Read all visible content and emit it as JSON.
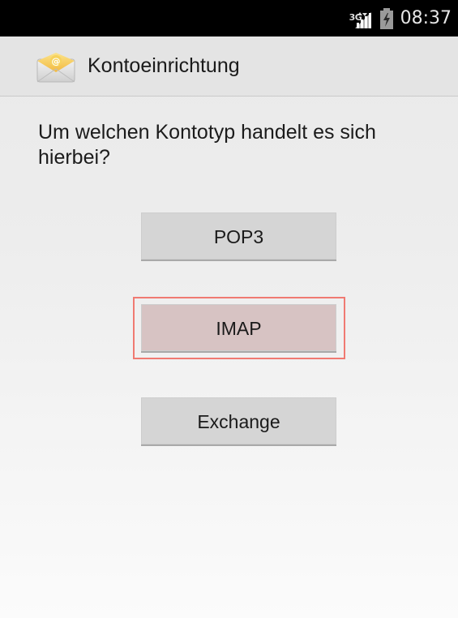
{
  "status_bar": {
    "network_type": "3G",
    "time": "08:37"
  },
  "action_bar": {
    "title": "Kontoeinrichtung",
    "icon": "email-app-icon"
  },
  "content": {
    "question": "Um welchen Kontotyp handelt es sich hierbei?",
    "options": [
      {
        "label": "POP3"
      },
      {
        "label": "IMAP",
        "highlighted": true
      },
      {
        "label": "Exchange"
      }
    ]
  },
  "colors": {
    "status_bar_bg": "#000000",
    "action_bar_bg": "#e4e4e4",
    "button_bg": "#d5d5d5",
    "highlight_border": "#f07a72",
    "highlight_button_bg": "#d7c3c3"
  }
}
